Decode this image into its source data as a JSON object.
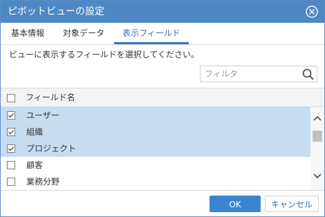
{
  "dialog": {
    "title": "ピボットビューの設定",
    "colors": {
      "titlebar": "#4e88c4",
      "accent": "#3278c2",
      "selected_row": "#c6dcf0",
      "ok_button": "#3a85d2"
    }
  },
  "tabs": [
    {
      "label": "基本情報",
      "active": false
    },
    {
      "label": "対象データ",
      "active": false
    },
    {
      "label": "表示フィールド",
      "active": true
    }
  ],
  "description": "ビューに表示するフィールドを選択してください。",
  "filter": {
    "placeholder": "フィルタ",
    "value": "",
    "icon": "search-icon"
  },
  "grid": {
    "header": "フィールド名",
    "header_checked": false,
    "rows": [
      {
        "label": "ユーザー",
        "checked": true,
        "selected": true
      },
      {
        "label": "組織",
        "checked": true,
        "selected": true
      },
      {
        "label": "プロジェクト",
        "checked": true,
        "selected": true
      },
      {
        "label": "顧客",
        "checked": false,
        "selected": false
      },
      {
        "label": "業務分野",
        "checked": false,
        "selected": false
      }
    ]
  },
  "buttons": {
    "ok": "OK",
    "cancel": "キャンセル"
  }
}
